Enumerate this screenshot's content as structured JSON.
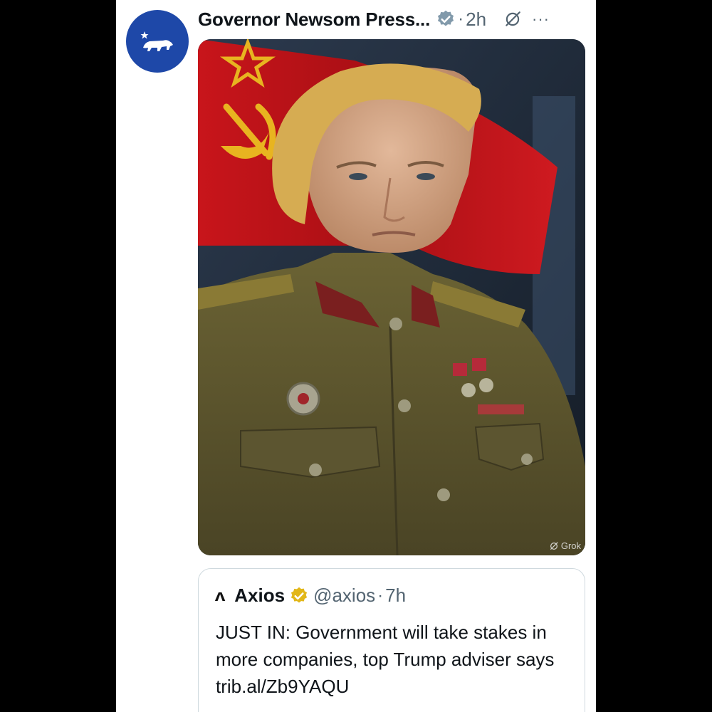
{
  "post": {
    "author": "Governor Newsom Press...",
    "time": "2h",
    "separator": "·",
    "more_label": "···",
    "icons": {
      "avatar": "california-bear-icon",
      "verified": "gray-verified-badge-icon",
      "grok": "grok-icon",
      "more": "more-options-icon"
    },
    "image_watermark": "Grok"
  },
  "quote": {
    "logo": "ʌ",
    "author": "Axios",
    "handle": "@axios",
    "separator": "·",
    "time": "7h",
    "text": "JUST IN: Government will take stakes in more companies, top Trump adviser says trib.al/Zb9YAQU",
    "icons": {
      "verified": "gold-verified-badge-icon"
    }
  },
  "colors": {
    "avatar_bg": "#1e48a8",
    "verified_gray": "#829aab",
    "verified_gold": "#e2b719",
    "secondary_text": "#536471"
  }
}
